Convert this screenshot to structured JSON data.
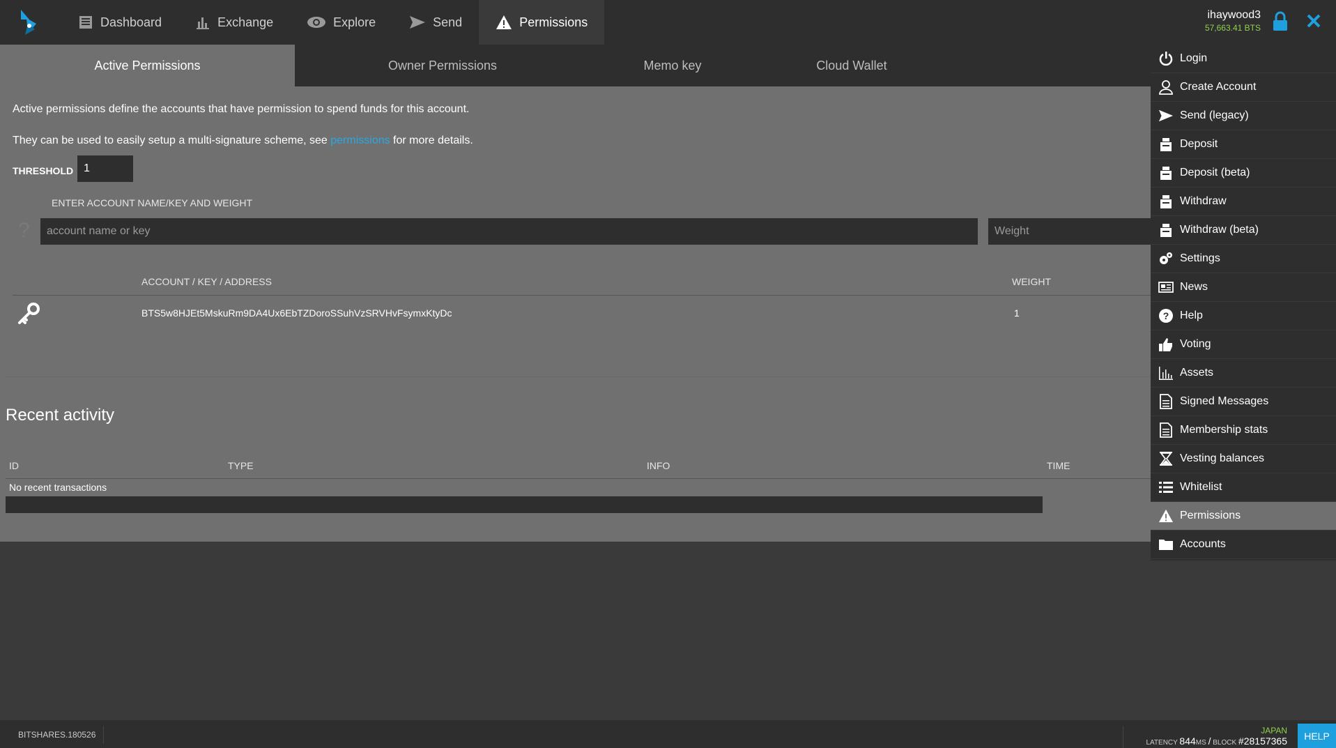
{
  "nav": {
    "items": [
      {
        "label": "Dashboard",
        "icon": "dashboard-icon"
      },
      {
        "label": "Exchange",
        "icon": "chart-icon"
      },
      {
        "label": "Explore",
        "icon": "eye-icon"
      },
      {
        "label": "Send",
        "icon": "send-icon"
      },
      {
        "label": "Permissions",
        "icon": "warning-icon"
      }
    ],
    "active": "Permissions"
  },
  "account": {
    "name": "ihaywood3",
    "balance": "57,663.41 BTS"
  },
  "tabs": [
    {
      "label": "Active Permissions"
    },
    {
      "label": "Owner Permissions"
    },
    {
      "label": "Memo key"
    },
    {
      "label": "Cloud Wallet"
    }
  ],
  "content": {
    "desc1": "Active permissions define the accounts that have permission to spend funds for this account.",
    "desc2_prefix": "They can be used to easily setup a multi-signature scheme, see ",
    "desc2_link": "permissions",
    "desc2_suffix": " for more details.",
    "threshold_label": "THRESHOLD",
    "threshold_value": "1",
    "enter_label": "ENTER ACCOUNT NAME/KEY AND WEIGHT",
    "account_placeholder": "account name or key",
    "weight_placeholder": "Weight",
    "table": {
      "headers": [
        "ACCOUNT / KEY / ADDRESS",
        "WEIGHT"
      ],
      "rows": [
        {
          "key": "BTS5w8HJEt5MskuRm9DA4Ux6EbTZDoroSSuhVzSRVHvFsymxKtyDc",
          "weight": "1"
        }
      ]
    }
  },
  "recent": {
    "title": "Recent activity",
    "headers": [
      "ID",
      "TYPE",
      "INFO",
      "TIME"
    ],
    "empty": "No recent transactions"
  },
  "sidemenu": {
    "items": [
      {
        "label": "Login",
        "icon": "power-icon"
      },
      {
        "label": "Create Account",
        "icon": "user-icon"
      },
      {
        "label": "Send (legacy)",
        "icon": "send-icon"
      },
      {
        "label": "Deposit",
        "icon": "deposit-icon"
      },
      {
        "label": "Deposit (beta)",
        "icon": "deposit-icon"
      },
      {
        "label": "Withdraw",
        "icon": "withdraw-icon"
      },
      {
        "label": "Withdraw (beta)",
        "icon": "withdraw-icon"
      },
      {
        "label": "Settings",
        "icon": "gear-icon"
      },
      {
        "label": "News",
        "icon": "news-icon"
      },
      {
        "label": "Help",
        "icon": "help-icon"
      },
      {
        "label": "Voting",
        "icon": "thumbs-up-icon"
      },
      {
        "label": "Assets",
        "icon": "chart-icon"
      },
      {
        "label": "Signed Messages",
        "icon": "document-icon"
      },
      {
        "label": "Membership stats",
        "icon": "document-icon"
      },
      {
        "label": "Vesting balances",
        "icon": "hourglass-icon"
      },
      {
        "label": "Whitelist",
        "icon": "list-icon"
      },
      {
        "label": "Permissions",
        "icon": "warning-icon"
      },
      {
        "label": "Accounts",
        "icon": "folder-icon"
      }
    ],
    "active": "Permissions"
  },
  "footer": {
    "version": "BITSHARES.180526",
    "node": "JAPAN",
    "latency_label": "LATENCY",
    "latency_value": "844",
    "latency_unit": "MS",
    "block_label": "BLOCK",
    "block_value": "#28157365",
    "help": "HELP"
  },
  "colors": {
    "accent": "#1fa0de",
    "balance": "#8fd14f",
    "link": "#2ba7e0"
  }
}
